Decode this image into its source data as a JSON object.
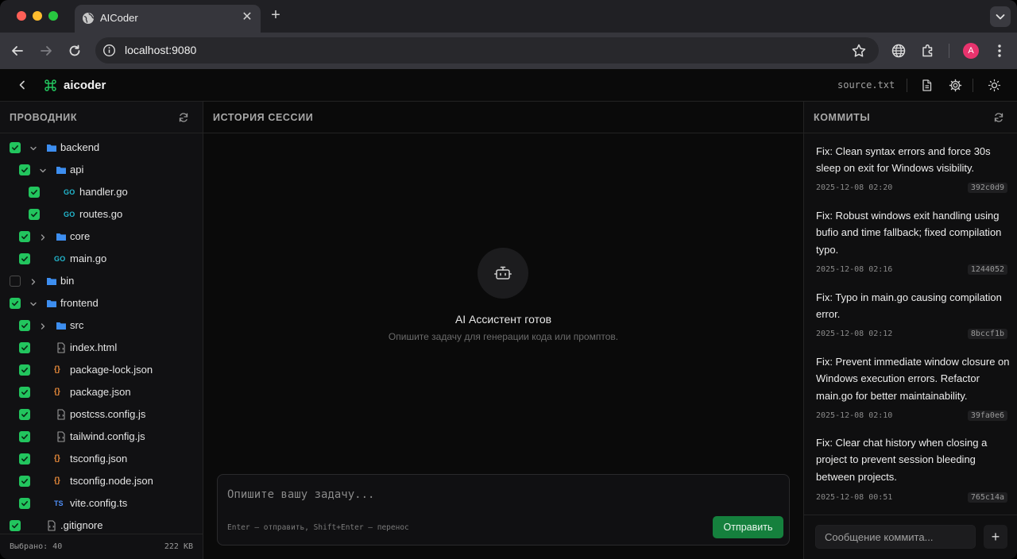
{
  "browser": {
    "tab_title": "AICoder",
    "url": "localhost:9080",
    "profile_initial": "A",
    "icons": [
      "globe-icon",
      "close-icon",
      "plus-icon",
      "chevron-down-icon",
      "back-arrow-icon",
      "forward-arrow-icon",
      "reload-icon",
      "info-icon",
      "star-icon",
      "translate-icon",
      "extensions-icon",
      "kebab-menu-icon"
    ]
  },
  "app": {
    "title": "aicoder",
    "source_file": "source.txt",
    "accent_color": "#22c55e"
  },
  "explorer": {
    "header": "ПРОВОДНИК",
    "items": [
      {
        "name": "backend",
        "type": "folder",
        "expanded": true,
        "checked": true,
        "depth": 0
      },
      {
        "name": "api",
        "type": "folder",
        "expanded": true,
        "checked": true,
        "depth": 1
      },
      {
        "name": "handler.go",
        "type": "go",
        "checked": true,
        "depth": 2
      },
      {
        "name": "routes.go",
        "type": "go",
        "checked": true,
        "depth": 2
      },
      {
        "name": "core",
        "type": "folder",
        "expanded": false,
        "checked": true,
        "depth": 1
      },
      {
        "name": "main.go",
        "type": "go",
        "checked": true,
        "depth": 1
      },
      {
        "name": "bin",
        "type": "folder",
        "expanded": false,
        "checked": false,
        "depth": 0
      },
      {
        "name": "frontend",
        "type": "folder",
        "expanded": true,
        "checked": true,
        "depth": 0
      },
      {
        "name": "src",
        "type": "folder",
        "expanded": false,
        "checked": true,
        "depth": 1
      },
      {
        "name": "index.html",
        "type": "file",
        "checked": true,
        "depth": 1
      },
      {
        "name": "package-lock.json",
        "type": "json",
        "checked": true,
        "depth": 1
      },
      {
        "name": "package.json",
        "type": "json",
        "checked": true,
        "depth": 1
      },
      {
        "name": "postcss.config.js",
        "type": "file",
        "checked": true,
        "depth": 1
      },
      {
        "name": "tailwind.config.js",
        "type": "file",
        "checked": true,
        "depth": 1
      },
      {
        "name": "tsconfig.json",
        "type": "json",
        "checked": true,
        "depth": 1
      },
      {
        "name": "tsconfig.node.json",
        "type": "json",
        "checked": true,
        "depth": 1
      },
      {
        "name": "vite.config.ts",
        "type": "ts",
        "checked": true,
        "depth": 1
      },
      {
        "name": ".gitignore",
        "type": "file",
        "checked": true,
        "depth": 0
      }
    ],
    "badges": {
      "go": "GO",
      "ts": "TS",
      "json": "{}"
    },
    "footer_selected": "Выбрано: 40",
    "footer_size": "222 KB"
  },
  "session": {
    "header": "ИСТОРИЯ СЕССИИ",
    "empty_title": "AI Ассистент готов",
    "empty_subtitle": "Опишите задачу для генерации кода или промптов.",
    "input_placeholder": "Опишите вашу задачу...",
    "hint": "Enter — отправить, Shift+Enter — перенос",
    "send_label": "Отправить"
  },
  "commits": {
    "header": "КОММИТЫ",
    "items": [
      {
        "message": "Fix: Clean syntax errors and force 30s sleep on exit for Windows visibility.",
        "date": "2025-12-08 02:20",
        "hash": "392c0d9"
      },
      {
        "message": "Fix: Robust windows exit handling using bufio and time fallback; fixed compilation typo.",
        "date": "2025-12-08 02:16",
        "hash": "1244052"
      },
      {
        "message": "Fix: Typo in main.go causing compilation error.",
        "date": "2025-12-08 02:12",
        "hash": "8bccf1b"
      },
      {
        "message": "Fix: Prevent immediate window closure on Windows execution errors. Refactor main.go for better maintainability.",
        "date": "2025-12-08 02:10",
        "hash": "39fa0e6"
      },
      {
        "message": "Fix: Clear chat history when closing a project to prevent session bleeding between projects.",
        "date": "2025-12-08 00:51",
        "hash": "765c14a"
      }
    ],
    "input_placeholder": "Сообщение коммита...",
    "add_label": "+"
  }
}
